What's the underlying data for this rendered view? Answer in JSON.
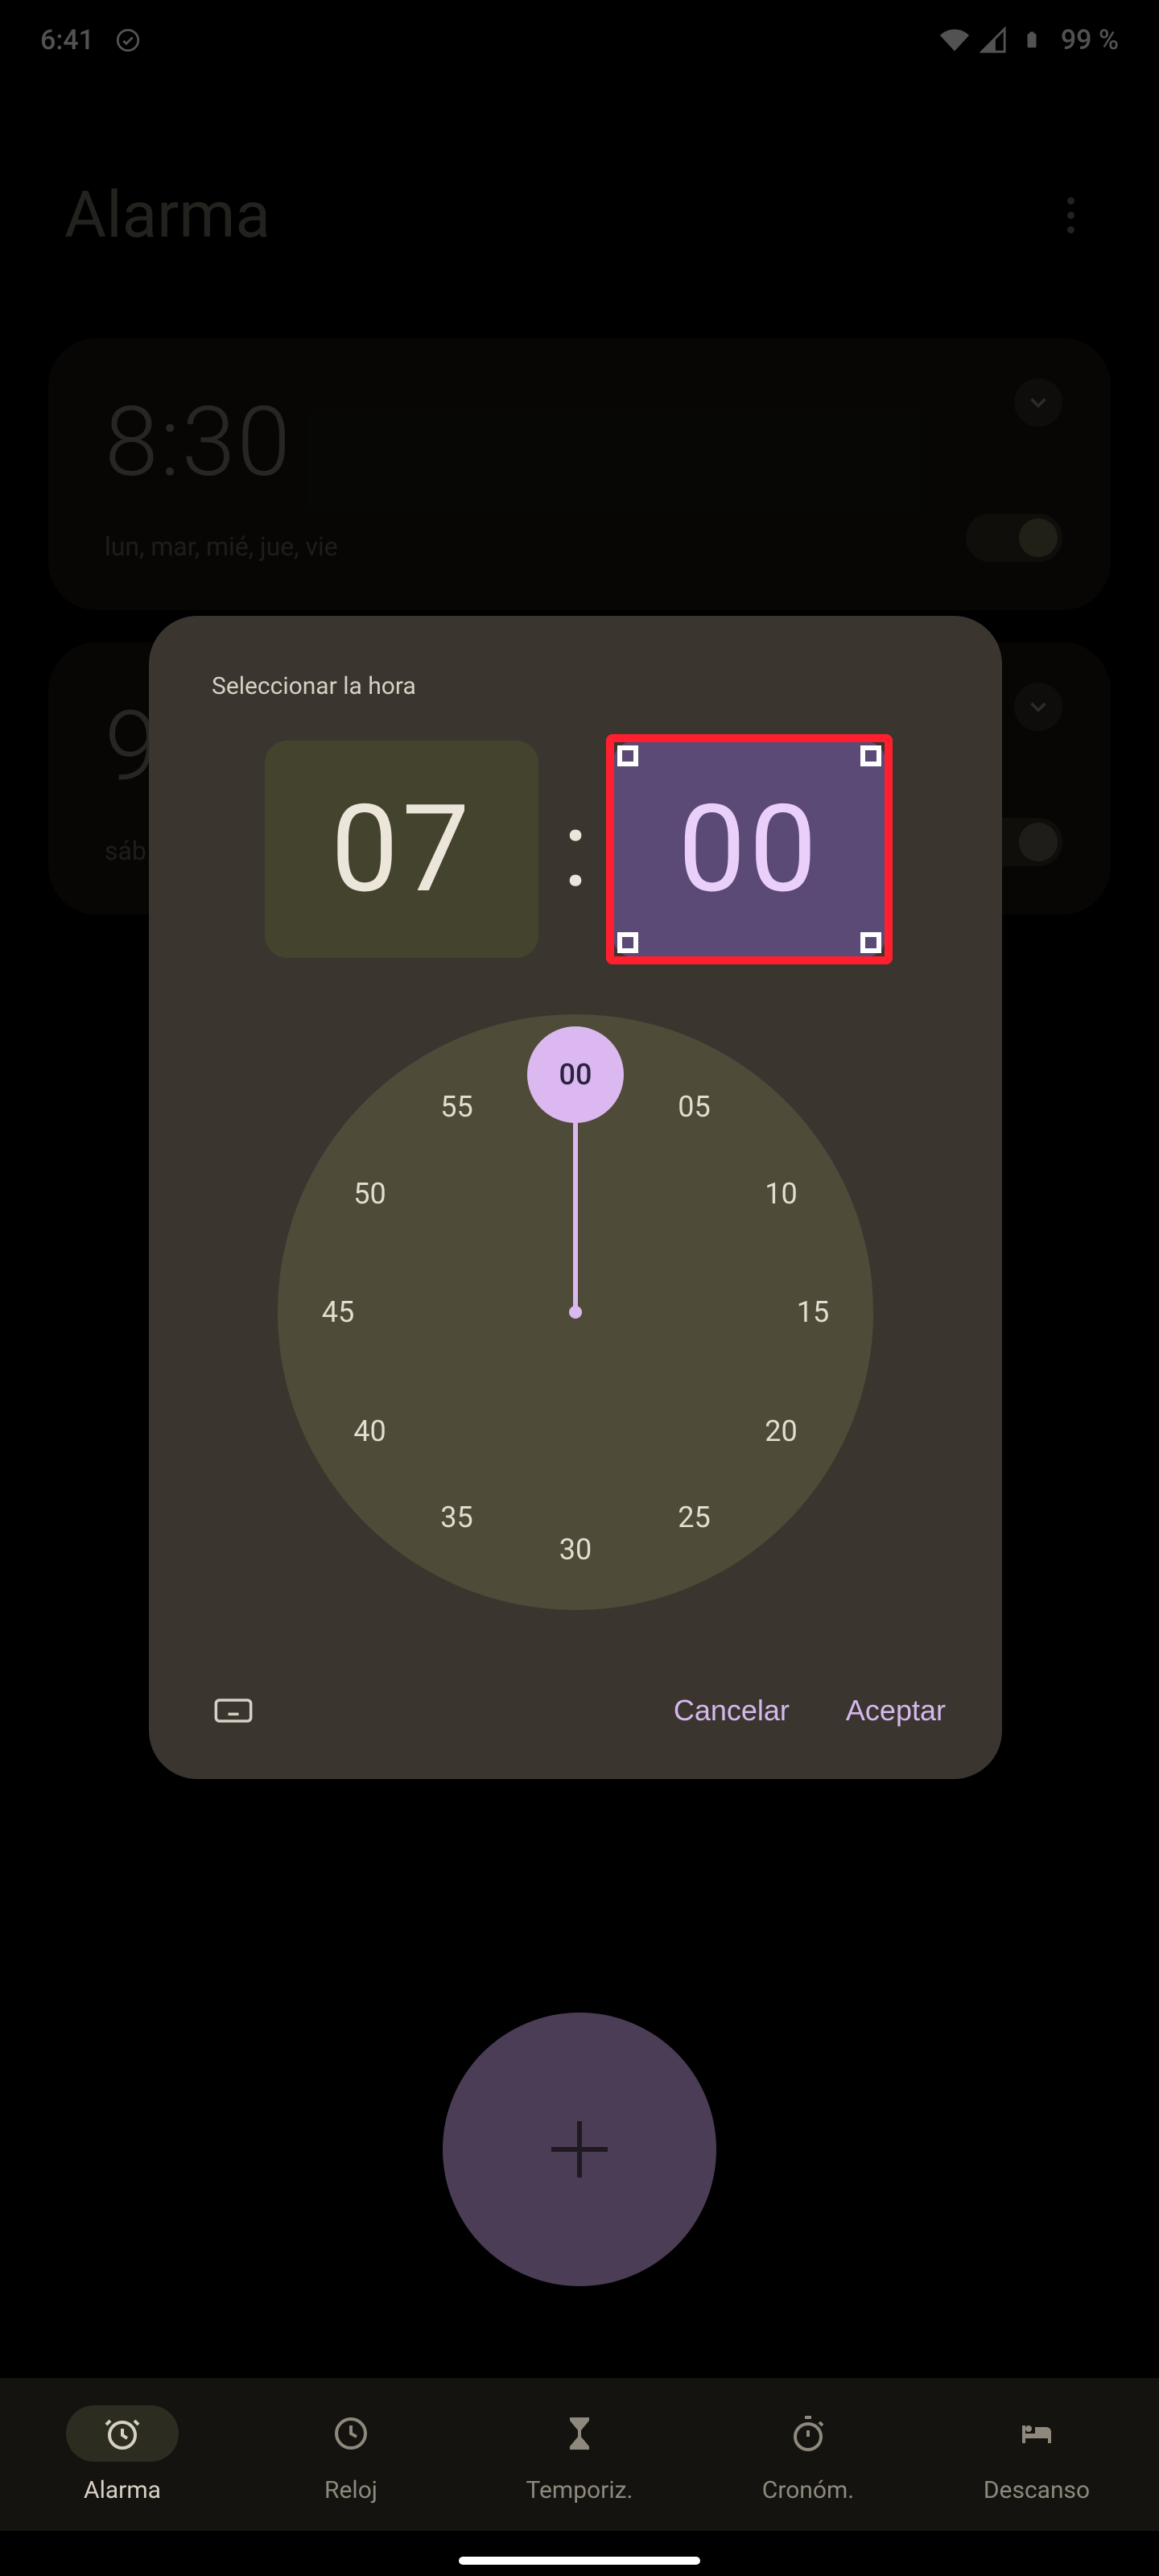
{
  "status_bar": {
    "time": "6:41",
    "battery_text": "99 %"
  },
  "header": {
    "title": "Alarma"
  },
  "alarms": [
    {
      "time": "8:30",
      "days": "lun, mar, mié, jue, vie"
    },
    {
      "time": "9",
      "days": "sáb"
    }
  ],
  "dialog": {
    "title": "Seleccionar la hora",
    "hour": "07",
    "minute": "00",
    "colon": ":",
    "cancel_label": "Cancelar",
    "accept_label": "Aceptar",
    "clock_selected": "00",
    "ticks": [
      "00",
      "05",
      "10",
      "15",
      "20",
      "25",
      "30",
      "35",
      "40",
      "45",
      "50",
      "55"
    ]
  },
  "fab": {
    "aria": "Añadir alarma"
  },
  "nav": {
    "items": [
      {
        "label": "Alarma",
        "icon": "alarm-icon",
        "active": true
      },
      {
        "label": "Reloj",
        "icon": "clock-icon",
        "active": false
      },
      {
        "label": "Temporiz.",
        "icon": "hourglass-icon",
        "active": false
      },
      {
        "label": "Cronóm.",
        "icon": "stopwatch-icon",
        "active": false
      },
      {
        "label": "Descanso",
        "icon": "bed-icon",
        "active": false
      }
    ]
  },
  "colors": {
    "accent_lilac": "#dbb8f0",
    "dialog_bg": "#3a362f",
    "clock_bg": "#4e4b38",
    "minute_selected_bg": "#5a4a75",
    "hour_bg": "#44432e",
    "highlight": "#ff1f2e"
  }
}
